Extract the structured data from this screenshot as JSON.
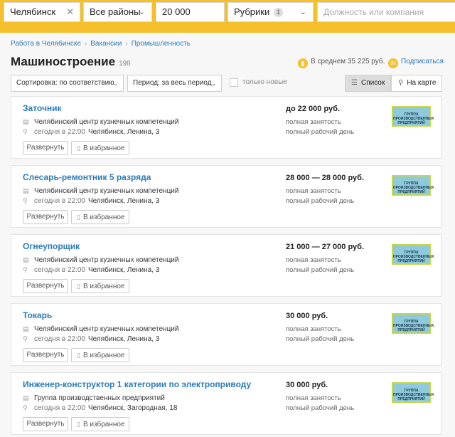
{
  "search": {
    "city": "Челябинск",
    "district": "Все районы",
    "salary": "20 000",
    "rubrics_label": "Рубрики",
    "rubrics_count": "1",
    "query_placeholder": "Должность или компания"
  },
  "breadcrumbs": [
    "Работа в Челябинске",
    "Вакансии",
    "Промышленность"
  ],
  "page": {
    "title": "Машиностроение",
    "count": "198",
    "average": "В среднем 35 225 руб.",
    "subscribe": "Подписаться"
  },
  "controls": {
    "sort": "Сортировка: по соответствию",
    "period": "Период: за весь период",
    "only_new": "только новые",
    "list": "Список",
    "map": "На карте"
  },
  "buttons": {
    "expand": "Развернуть",
    "favorite": "В избранное"
  },
  "colors": {
    "accent": "#f4c02c",
    "link": "#2b7bb9"
  },
  "vacancies": [
    {
      "title": "Заточник",
      "company": "Челябинский центр кузнечных компетенций",
      "time": "сегодня в 22:00",
      "address": "Челябинск, Ленина, 3",
      "salary": "до 22 000 руб.",
      "employment": "полная занятость",
      "schedule": "полный рабочий день",
      "logo_text": "ГРУППА ПРОИЗВОДСТВЕННЫХ ПРЕДПРИЯТИЙ"
    },
    {
      "title": "Слесарь-ремонтник 5 разряда",
      "company": "Челябинский центр кузнечных компетенций",
      "time": "сегодня в 22:00",
      "address": "Челябинск, Ленина, 3",
      "salary": "28 000 — 28 000 руб.",
      "employment": "полная занятость",
      "schedule": "полный рабочий день",
      "logo_text": "ГРУППА ПРОИЗВОДСТВЕННЫХ ПРЕДПРИЯТИЙ"
    },
    {
      "title": "Огнеупорщик",
      "company": "Челябинский центр кузнечных компетенций",
      "time": "сегодня в 22:00",
      "address": "Челябинск, Ленина, 3",
      "salary": "21 000 — 27 000 руб.",
      "employment": "полная занятость",
      "schedule": "полный рабочий день",
      "logo_text": "ГРУППА ПРОИЗВОДСТВЕННЫХ ПРЕДПРИЯТИЙ"
    },
    {
      "title": "Токарь",
      "company": "Челябинский центр кузнечных компетенций",
      "time": "сегодня в 22:00",
      "address": "Челябинск, Ленина, 3",
      "salary": "30 000 руб.",
      "employment": "полная занятость",
      "schedule": "полный рабочий день",
      "logo_text": "ГРУППА ПРОИЗВОДСТВЕННЫХ ПРЕДПРИЯТИЙ"
    },
    {
      "title": "Инженер-конструктор 1 категории по электроприводу",
      "company": "Группа производственных предприятий",
      "time": "сегодня в 22:00",
      "address": "Челябинск, Загородная, 18",
      "salary": "30 000 руб.",
      "employment": "полная занятость",
      "schedule": "полный рабочий день",
      "logo_text": "ГРУППА ПРОИЗВОДСТВЕННЫХ ПРЕДПРИЯТИЙ"
    }
  ]
}
